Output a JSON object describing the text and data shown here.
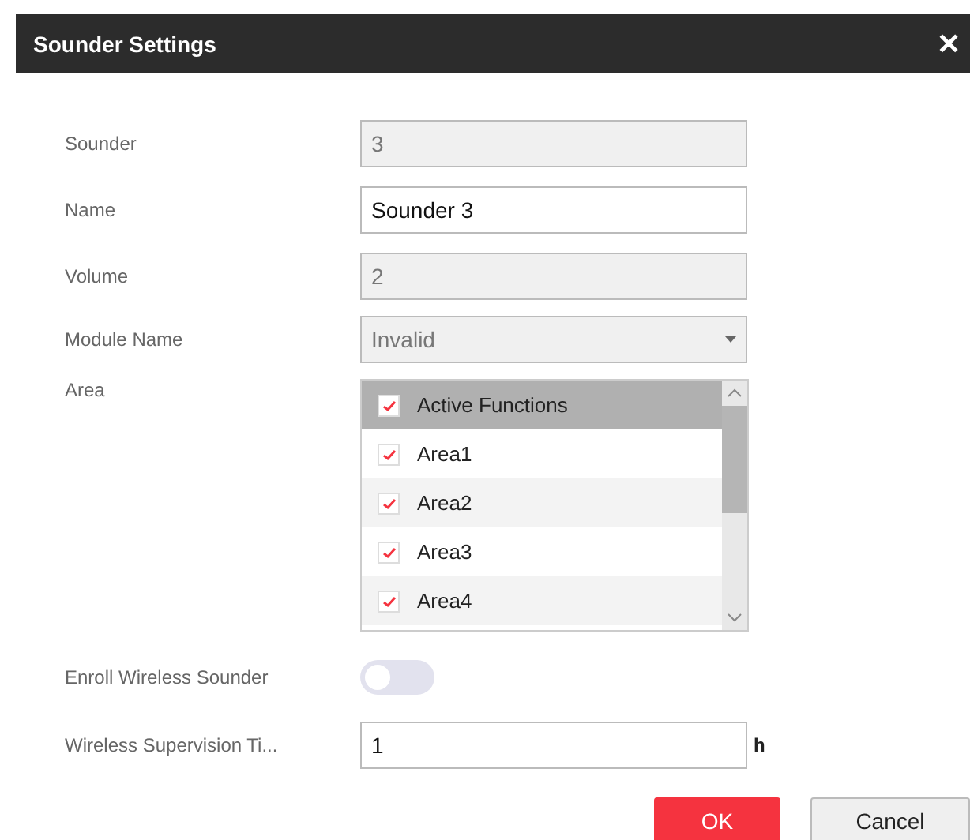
{
  "dialog": {
    "title": "Sounder Settings",
    "close": "✕"
  },
  "fields": [
    {
      "label": "Sounder",
      "kind": "text",
      "value": "3",
      "disabled": true
    },
    {
      "label": "Name",
      "kind": "text",
      "value": "Sounder 3",
      "disabled": false
    },
    {
      "label": "Volume",
      "kind": "text",
      "value": "2",
      "disabled": true
    },
    {
      "label": "Module Name",
      "kind": "select",
      "value": "Invalid",
      "disabled": true
    }
  ],
  "area": {
    "label": "Area",
    "items": [
      {
        "label": "Active Functions",
        "checked": true,
        "selected": true
      },
      {
        "label": "Area1",
        "checked": true,
        "selected": false
      },
      {
        "label": "Area2",
        "checked": true,
        "selected": false
      },
      {
        "label": "Area3",
        "checked": true,
        "selected": false
      },
      {
        "label": "Area4",
        "checked": true,
        "selected": false
      }
    ]
  },
  "enroll": {
    "label": "Enroll Wireless Sounder",
    "on": false
  },
  "supervision": {
    "label": "Wireless Supervision Ti...",
    "value": "1",
    "unit": "h"
  },
  "buttons": [
    {
      "label": "OK",
      "kind": "primary"
    },
    {
      "label": "Cancel",
      "kind": "secondary"
    }
  ]
}
